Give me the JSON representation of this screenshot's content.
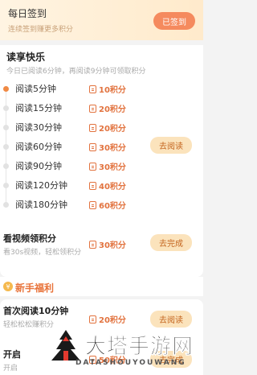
{
  "checkin": {
    "title": "每日签到",
    "subtitle": "连续签到赚更多积分",
    "button": "已签到"
  },
  "reading": {
    "title": "读享快乐",
    "subtitle": "今日已阅读6分钟，再阅读9分钟可领取积分",
    "tiers": [
      {
        "label": "阅读5分钟",
        "reward": "10积分"
      },
      {
        "label": "阅读15分钟",
        "reward": "20积分"
      },
      {
        "label": "阅读30分钟",
        "reward": "20积分"
      },
      {
        "label": "阅读60分钟",
        "reward": "30积分"
      },
      {
        "label": "阅读90分钟",
        "reward": "30积分"
      },
      {
        "label": "阅读120分钟",
        "reward": "40积分"
      },
      {
        "label": "阅读180分钟",
        "reward": "60积分"
      }
    ],
    "go_button": "去阅读",
    "video": {
      "title": "看视频领积分",
      "subtitle": "看30s视频，轻松领积分",
      "reward": "30积分",
      "button": "去完成"
    }
  },
  "newbie": {
    "badge": "¥",
    "title": "新手福利",
    "tasks": [
      {
        "title": "首次阅读10分钟",
        "subtitle": "轻松松松赚积分",
        "reward": "20积分",
        "button": "去阅读"
      },
      {
        "title": "开启",
        "subtitle": "开启",
        "reward": "50积分",
        "button": "去完成"
      }
    ]
  },
  "watermark": {
    "title": "大塔手游网",
    "subtitle": "DATASHOUYOUWANG"
  },
  "colors": {
    "accent": "#f08a44",
    "reward": "#e2733f",
    "button_bg": "#fbe3bc",
    "checkin_btn": "#f58a5e"
  }
}
